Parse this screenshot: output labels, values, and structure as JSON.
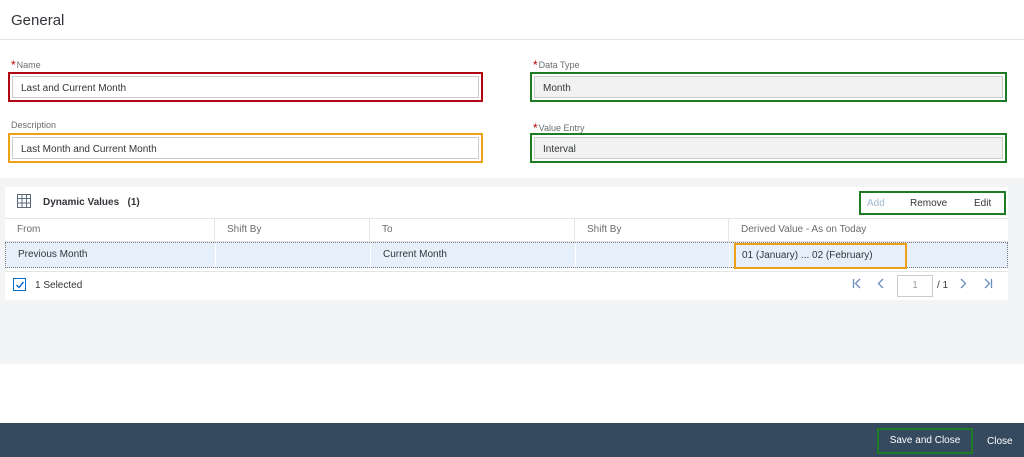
{
  "header": {
    "title": "General"
  },
  "form": {
    "name": {
      "label": "Name",
      "required_mark": "*",
      "value": "Last and Current Month"
    },
    "description": {
      "label": "Description",
      "value": "Last Month and Current Month"
    },
    "data_type": {
      "label": "Data Type",
      "required_mark": "*",
      "value": "Month"
    },
    "value_entry": {
      "label": "Value Entry",
      "required_mark": "*",
      "value": "Interval"
    }
  },
  "table": {
    "title": "Dynamic Values",
    "count": "(1)",
    "actions": {
      "add": "Add",
      "remove": "Remove",
      "edit": "Edit"
    },
    "columns": [
      "From",
      "Shift By",
      "To",
      "Shift By",
      "Derived Value - As on Today"
    ],
    "rows": [
      {
        "from": "Previous Month",
        "shift_by_1": "",
        "to": "Current Month",
        "shift_by_2": "",
        "derived": "01 (January) ... 02 (February)"
      }
    ],
    "selected_text": "1 Selected",
    "pagination": {
      "page": "1",
      "total": "/ 1"
    }
  },
  "footer": {
    "save_close": "Save and Close",
    "close": "Close"
  },
  "colors": {
    "accent": "#0a6ed1",
    "footer_bg": "#354a5f",
    "highlight_red": "#b00712",
    "highlight_orange": "#f0a018",
    "highlight_green": "#1f7a24"
  }
}
